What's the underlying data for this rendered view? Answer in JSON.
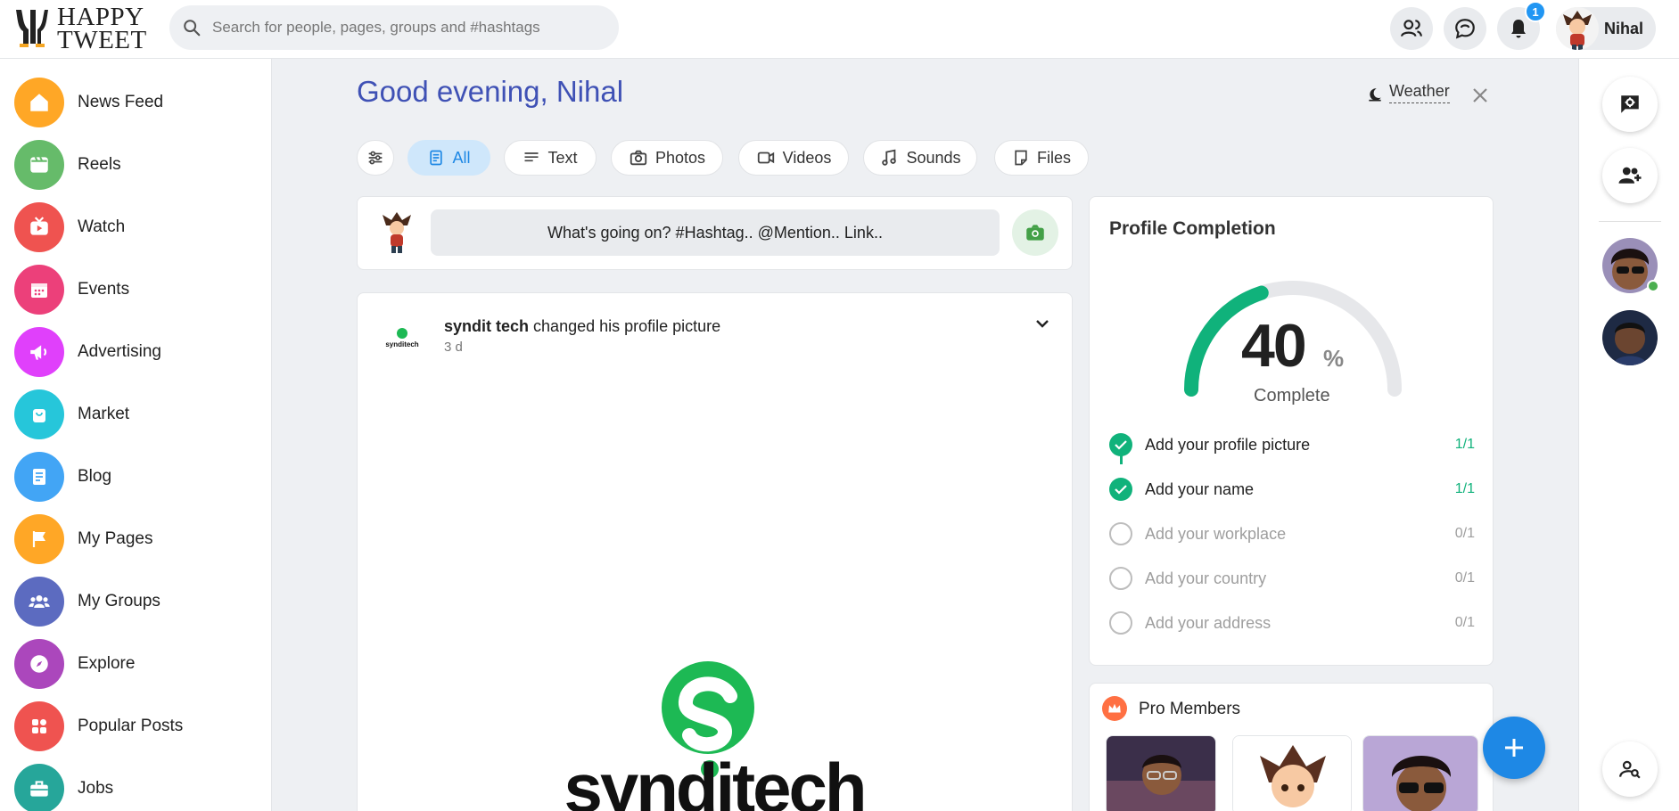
{
  "header": {
    "logo_line1": "HAPPY",
    "logo_line2": "TWEET",
    "search_placeholder": "Search for people, pages, groups and #hashtags",
    "notification_count": "1",
    "user_name": "Nihal",
    "icons": [
      "friends-icon",
      "messages-icon",
      "notifications-icon"
    ]
  },
  "sidebar": {
    "items": [
      {
        "label": "News Feed",
        "color": "#ffa726",
        "icon": "home-icon"
      },
      {
        "label": "Reels",
        "color": "#66bb6a",
        "icon": "reels-icon"
      },
      {
        "label": "Watch",
        "color": "#ef5350",
        "icon": "watch-icon"
      },
      {
        "label": "Events",
        "color": "#ec407a",
        "icon": "calendar-icon"
      },
      {
        "label": "Advertising",
        "color": "#e040fb",
        "icon": "megaphone-icon"
      },
      {
        "label": "Market",
        "color": "#26c6da",
        "icon": "shopping-bag-icon"
      },
      {
        "label": "Blog",
        "color": "#42a5f5",
        "icon": "blog-icon"
      },
      {
        "label": "My Pages",
        "color": "#ffa726",
        "icon": "flag-icon"
      },
      {
        "label": "My Groups",
        "color": "#5c6bc0",
        "icon": "groups-icon"
      },
      {
        "label": "Explore",
        "color": "#ab47bc",
        "icon": "compass-icon"
      },
      {
        "label": "Popular Posts",
        "color": "#ef5350",
        "icon": "grid-icon"
      },
      {
        "label": "Jobs",
        "color": "#26a69a",
        "icon": "briefcase-icon"
      }
    ]
  },
  "main": {
    "greeting": "Good evening, Nihal",
    "weather_label": "Weather",
    "filters": [
      {
        "label": "All",
        "icon": "document-icon",
        "active": true
      },
      {
        "label": "Text",
        "icon": "text-lines-icon"
      },
      {
        "label": "Photos",
        "icon": "camera-icon"
      },
      {
        "label": "Videos",
        "icon": "video-icon"
      },
      {
        "label": "Sounds",
        "icon": "music-note-icon"
      },
      {
        "label": "Files",
        "icon": "file-icon"
      }
    ],
    "composer_placeholder": "What's going on? #Hashtag.. @Mention.. Link..",
    "post": {
      "author": "syndit tech",
      "action": "changed his profile picture",
      "time": "3 d",
      "logo_text_small": "synditech",
      "logo_text_big": "synditech"
    }
  },
  "profile_completion": {
    "title": "Profile Completion",
    "percent": "40",
    "percent_sign": "%",
    "complete_label": "Complete",
    "progress_fraction": 0.4,
    "accent_color": "#10b27b",
    "items": [
      {
        "label": "Add your profile picture",
        "count": "1/1",
        "done": true
      },
      {
        "label": "Add your name",
        "count": "1/1",
        "done": true
      },
      {
        "label": "Add your workplace",
        "count": "0/1",
        "done": false
      },
      {
        "label": "Add your country",
        "count": "0/1",
        "done": false
      },
      {
        "label": "Add your address",
        "count": "0/1",
        "done": false
      }
    ]
  },
  "pro_members": {
    "title": "Pro Members"
  },
  "right_rail": {
    "buttons": [
      "chat-settings-icon",
      "add-friend-icon",
      "search-user-icon"
    ]
  }
}
